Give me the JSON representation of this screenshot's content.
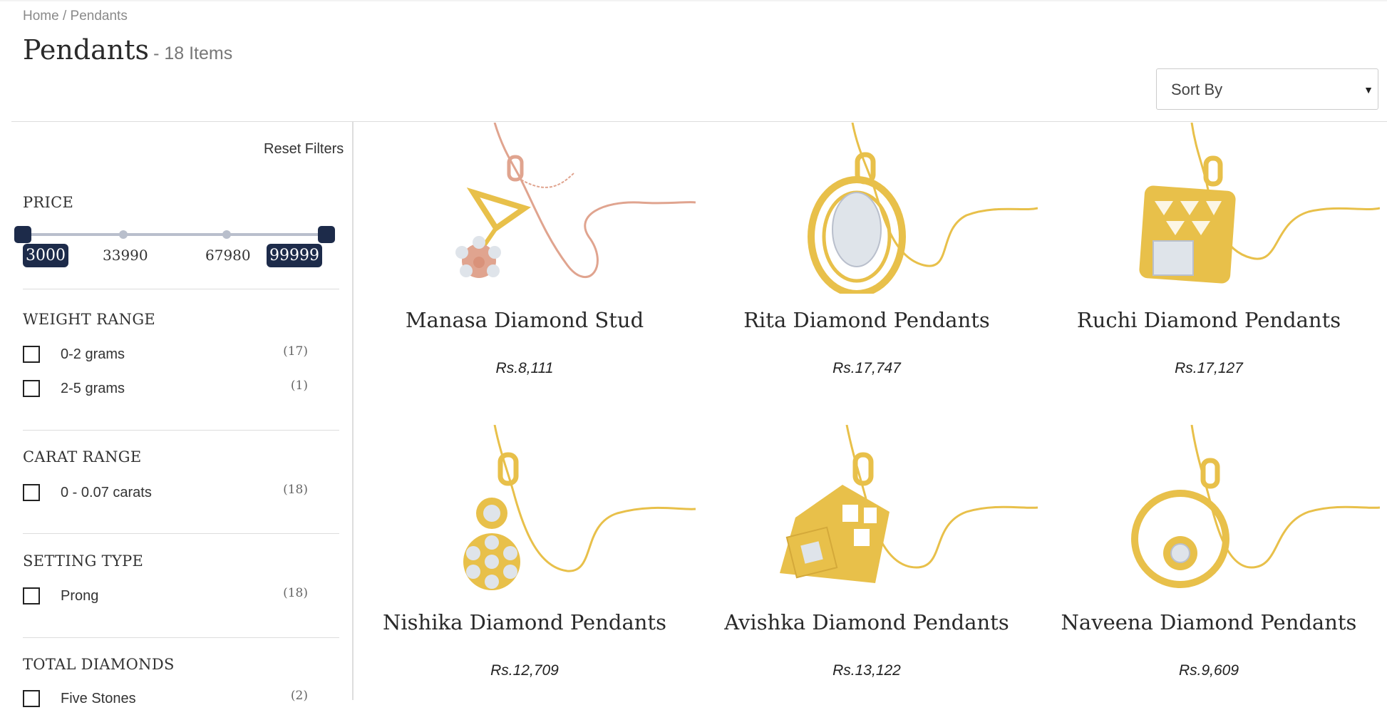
{
  "breadcrumb": {
    "home": "Home",
    "sep": " / ",
    "current": "Pendants"
  },
  "page": {
    "title": "Pendants",
    "count": "- 18 Items"
  },
  "sort": {
    "label": "Sort By",
    "caret": "▼"
  },
  "filters": {
    "reset_label": "Reset Filters",
    "price": {
      "heading": "PRICE",
      "min": "3000",
      "tick1": "33990",
      "tick2": "67980",
      "max": "99999"
    },
    "weight": {
      "heading": "WEIGHT RANGE",
      "options": [
        {
          "label": "0-2 grams",
          "count": "(17)"
        },
        {
          "label": "2-5 grams",
          "count": "(1)"
        }
      ]
    },
    "carat": {
      "heading": "CARAT RANGE",
      "options": [
        {
          "label": "0 - 0.07 carats",
          "count": "(18)"
        }
      ]
    },
    "setting": {
      "heading": "SETTING TYPE",
      "options": [
        {
          "label": "Prong",
          "count": "(18)"
        }
      ]
    },
    "diamonds": {
      "heading": "TOTAL DIAMONDS",
      "options": [
        {
          "label": "Five Stones",
          "count": "(2)"
        }
      ]
    }
  },
  "products": [
    {
      "name": "Manasa Diamond Stud",
      "price": "Rs.8,111",
      "metal": "rose",
      "icon": "flower-pendant-icon"
    },
    {
      "name": "Rita Diamond Pendants",
      "price": "Rs.17,747",
      "metal": "gold",
      "icon": "oval-pendant-icon"
    },
    {
      "name": "Ruchi Diamond Pendants",
      "price": "Rs.17,127",
      "metal": "gold",
      "icon": "square-pendant-icon"
    },
    {
      "name": "Nishika Diamond Pendants",
      "price": "Rs.12,709",
      "metal": "gold",
      "icon": "floral-drop-pendant-icon"
    },
    {
      "name": "Avishka Diamond Pendants",
      "price": "Rs.13,122",
      "metal": "gold",
      "icon": "diamond-square-pendant-icon"
    },
    {
      "name": "Naveena Diamond Pendants",
      "price": "Rs.9,609",
      "metal": "gold",
      "icon": "ring-pendant-icon"
    }
  ],
  "colors": {
    "accent": "#1d2b4a",
    "gold": "#e8c04a",
    "rose": "#e0a48f",
    "diamond": "#dfe4ea"
  }
}
